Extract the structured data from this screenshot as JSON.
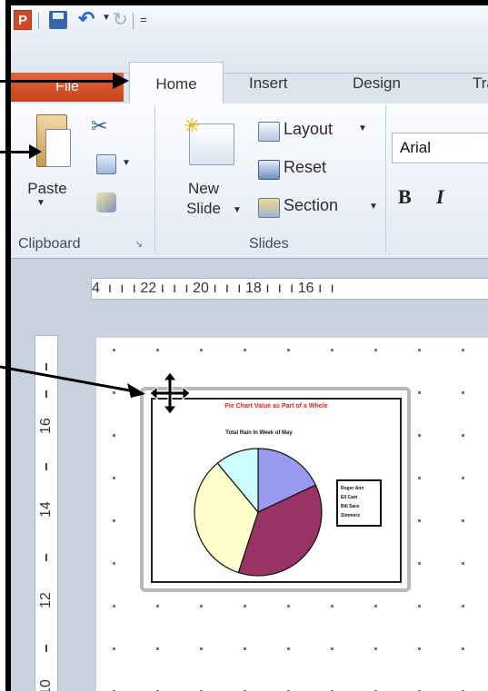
{
  "app": {
    "logo_letter": "P"
  },
  "quick_access": {
    "save": "save-icon",
    "undo": "undo-icon",
    "redo": "redo-icon",
    "customize": "="
  },
  "tabs": [
    {
      "label": "File"
    },
    {
      "label": "Home"
    },
    {
      "label": "Insert"
    },
    {
      "label": "Design"
    },
    {
      "label": "Tra"
    }
  ],
  "ribbon": {
    "clipboard": {
      "paste_label": "Paste",
      "group_label": "Clipboard"
    },
    "slides": {
      "new_slide_line1": "New",
      "new_slide_line2": "Slide",
      "layout": "Layout",
      "reset": "Reset",
      "section": "Section",
      "group_label": "Slides"
    },
    "font": {
      "font_name": "Arial",
      "bold": "B",
      "italic": "I"
    }
  },
  "ruler": {
    "horizontal": "4  ı  ı  ı 22 ı  ı  ı 20 ı  ı  ı 18 ı  ı  ı 16 ı  ı",
    "vertical_labels": [
      "16",
      "14",
      "12",
      "10"
    ]
  },
  "chart": {
    "title": "Pie Chart   Value as Part of a Whole",
    "subtitle": "Total Rain In Week of May",
    "legend": [
      "Roger Ann",
      "Ell Cam",
      "Bill Sara",
      "Simmers"
    ]
  },
  "chart_data": {
    "type": "pie",
    "title": "Pie Chart   Value as Part of a Whole",
    "subtitle": "Total Rain In Week of May",
    "categories": [
      "Roger Ann",
      "Ell Cam",
      "Bill Sara",
      "Simmers"
    ],
    "values": [
      18,
      37,
      34,
      11
    ],
    "colors": [
      "#9999ee",
      "#993366",
      "#ffffcc",
      "#ccffff"
    ],
    "legend_position": "right"
  }
}
